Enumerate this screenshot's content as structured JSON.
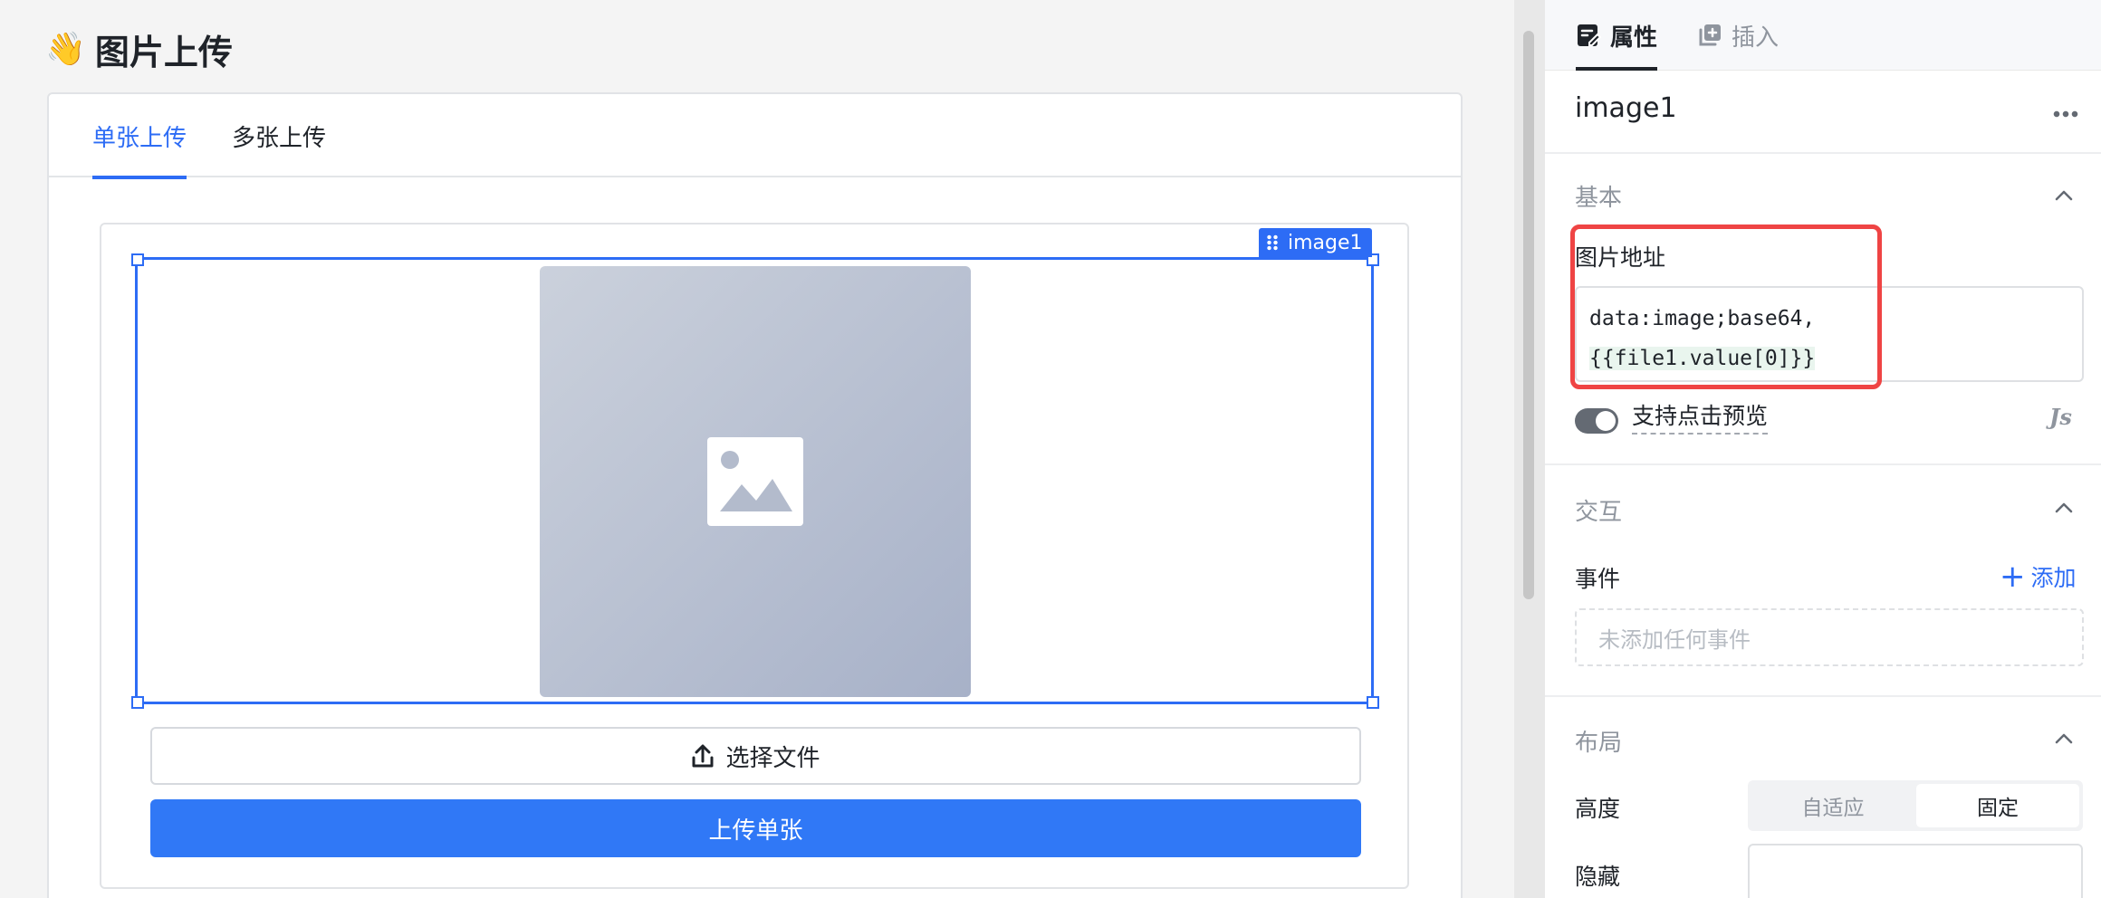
{
  "canvas": {
    "title_emoji": "👋",
    "title": "图片上传",
    "tabs": [
      "单张上传",
      "多张上传"
    ],
    "image_tag": "image1",
    "select_file_label": "选择文件",
    "upload_label": "上传单张"
  },
  "panel": {
    "tabs": [
      "属性",
      "插入"
    ],
    "component_name": "image1",
    "sections": {
      "basic": {
        "title": "基本",
        "image_url_label": "图片地址",
        "image_url_line1": "data:image;base64,",
        "image_url_line2": "{{file1.value[0]}}",
        "preview_toggle_label": "支持点击预览",
        "preview_toggle_on": true,
        "js_icon": "Js"
      },
      "interaction": {
        "title": "交互",
        "events_label": "事件",
        "add_label": "添加",
        "empty_events": "未添加任何事件"
      },
      "layout": {
        "title": "布局",
        "height_label": "高度",
        "height_options": [
          "自适应",
          "固定"
        ],
        "height_selected": "固定",
        "hidden_label": "隐藏"
      }
    }
  },
  "icons": {
    "ptab_props": "edit-doc-icon",
    "ptab_insert": "add-square-icon",
    "image_placeholder": "image-icon",
    "upload": "upload-icon",
    "more": "more-horizontal-icon",
    "collapse": "chevron-up-icon",
    "drag": "drag-handle-icon"
  },
  "colors": {
    "accent": "#2d6cf5",
    "primary_button": "#3078f6",
    "highlight_frame": "#ef4444"
  }
}
